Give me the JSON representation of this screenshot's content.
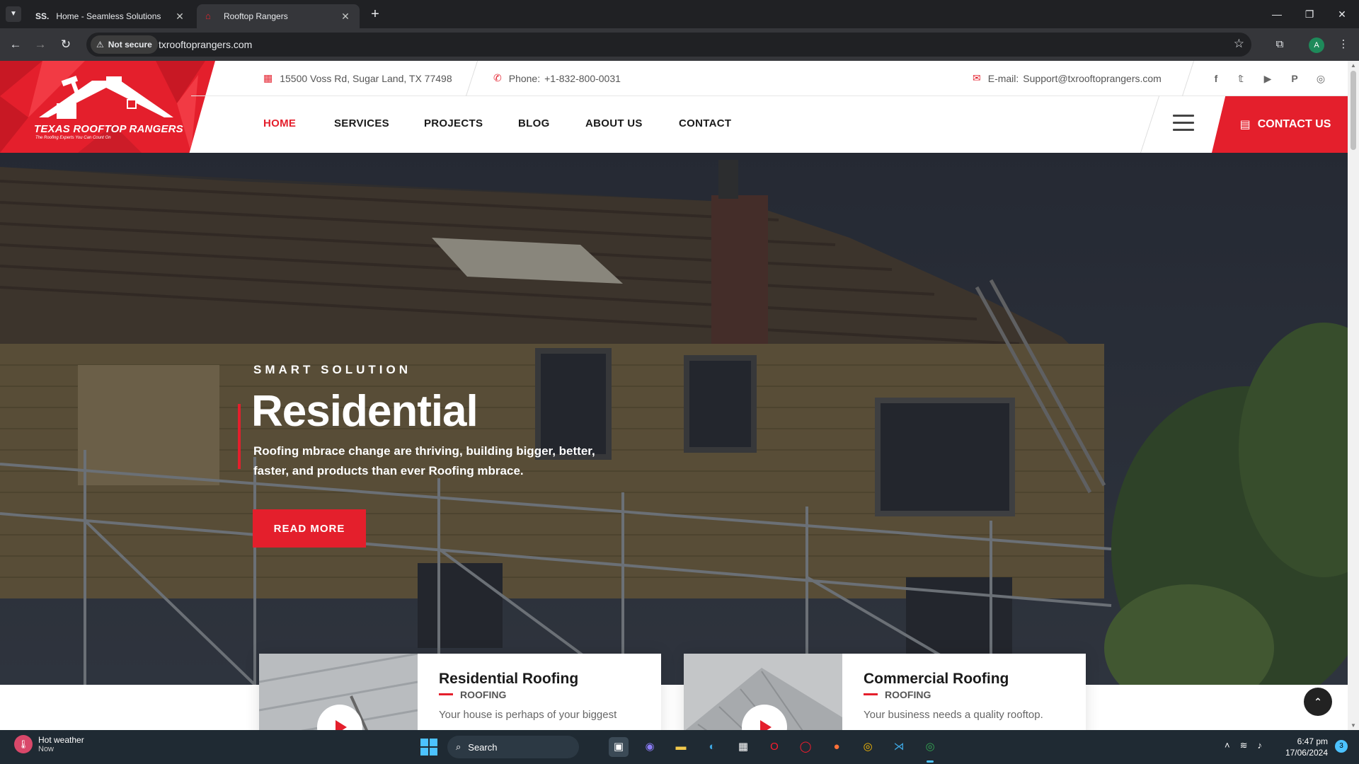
{
  "browser": {
    "tabs": [
      {
        "favicon": "SS.",
        "title": "Home - Seamless Solutions"
      },
      {
        "favicon": "rooftop-logo",
        "title": "Rooftop Rangers"
      }
    ],
    "security_label": "Not secure",
    "url": "txrooftoprangers.com",
    "profile_initial": "A"
  },
  "site": {
    "logo_text": "TEXAS ROOFTOP RANGERS",
    "logo_tagline": "The Roofing Experts You Can Count On",
    "topbar": {
      "address": "15500 Voss Rd, Sugar Land, TX 77498",
      "phone_label": "Phone:",
      "phone": "+1-832-800-0031",
      "email_label": "E-mail:",
      "email": "Support@txrooftoprangers.com"
    },
    "nav": [
      "HOME",
      "SERVICES",
      "PROJECTS",
      "BLOG",
      "ABOUT US",
      "CONTACT"
    ],
    "contact_button": "CONTACT US",
    "hero": {
      "eyebrow": "SMART SOLUTION",
      "title": "Residential",
      "description": "Roofing mbrace change are thriving, building bigger, better, faster, and products than ever Roofing mbrace.",
      "button": "READ MORE"
    },
    "cards": [
      {
        "title": "Residential Roofing",
        "category": "ROOFING",
        "description": "Your house is perhaps of your biggest"
      },
      {
        "title": "Commercial Roofing",
        "category": "ROOFING",
        "description": "Your business needs a quality rooftop."
      }
    ]
  },
  "taskbar": {
    "weather_title": "Hot weather",
    "weather_sub": "Now",
    "search_label": "Search",
    "time": "6:47 pm",
    "date": "17/06/2024",
    "notifications": "3"
  },
  "colors": {
    "accent": "#e41f2c",
    "chrome_dark": "#202124",
    "taskbar": "#1f2a33"
  }
}
